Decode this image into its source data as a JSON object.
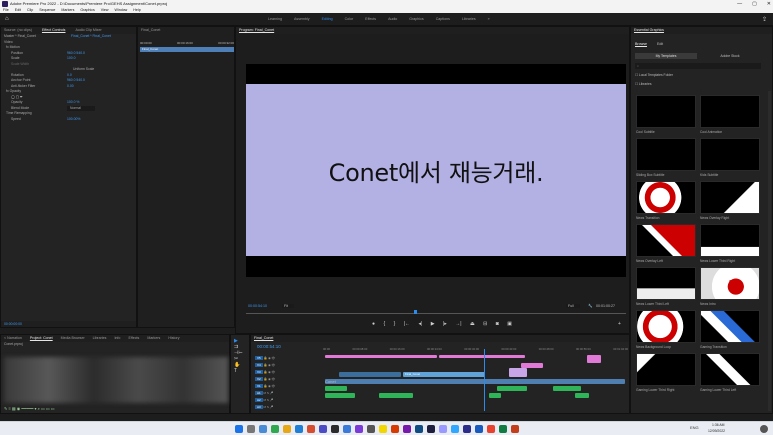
{
  "window": {
    "title": "Adobe Premiere Pro 2022 - D:\\Documents\\Premiere Pro\\GEHS Assignment\\Conet.prproj",
    "controls": [
      "—",
      "▢",
      "✕"
    ]
  },
  "menu": [
    "File",
    "Edit",
    "Clip",
    "Sequence",
    "Markers",
    "Graphics",
    "View",
    "Window",
    "Help"
  ],
  "workspaces": {
    "tabs": [
      "Learning",
      "Assembly",
      "Editing",
      "Color",
      "Effects",
      "Audio",
      "Graphics",
      "Captions",
      "Libraries"
    ],
    "active": "Editing",
    "more": "»"
  },
  "source_panel": {
    "tabs": [
      "Source: (no clips)",
      "Effect Controls",
      "Audio Clip Mixer"
    ],
    "master": "Master * Final_Conet",
    "sequence": "Final_Conet * Final_Conet",
    "rows": [
      "Video",
      "fx Motion",
      "Position",
      "Scale",
      "Scale Width",
      "Uniform Scale",
      "Rotation",
      "Anchor Point",
      "Anti-flicker Filter",
      "fx Opacity",
      "Opacity",
      "Blend Mode",
      "Time Remapping",
      "Speed"
    ],
    "values": {
      "position": "960.0   540.0",
      "scale": "100.0",
      "rotation": "0.0",
      "anchor": "960.0   540.0",
      "antiflicker": "0.00",
      "opacity": "100.0 %",
      "blend": "Normal",
      "speed": "100.00%"
    },
    "timecode": "00:00:00:00",
    "clip_times": [
      "00:00:00",
      "00:00:16:00",
      "00:00:32:00"
    ],
    "clip_name": "Final_Conet"
  },
  "project_panel": {
    "tabs": [
      "< Narration",
      "Project: Conet",
      "Media Browser",
      "Libraries",
      "Info",
      "Effects",
      "Markers",
      "History"
    ],
    "file": "Conet.prproj"
  },
  "program_monitor": {
    "title": "Program: Final_Conet",
    "timecode": "00:00:54:10",
    "fit": "Fit",
    "quality": "Full",
    "duration": "00:01:00:27",
    "caption": "Conet에서 재능거래."
  },
  "timeline": {
    "tab": "Final_Conet",
    "timecode": "00:00:54:10",
    "ruler": [
      "00:00",
      "00:00:08:00",
      "00:00:16:00",
      "00:00:24:00",
      "00:00:32:00",
      "00:00:40:00",
      "00:00:48:00",
      "00:00:56:00",
      "00:01:04:00"
    ],
    "tracks": [
      "V5",
      "V4",
      "V3",
      "V2",
      "V1",
      "A1",
      "A2",
      "A3"
    ],
    "clips": [
      "Final_Conet",
      "Conet"
    ]
  },
  "essential_graphics": {
    "title": "Essential Graphics",
    "tabs": [
      "Browse",
      "Edit"
    ],
    "my_templates": "My Templates",
    "adobe_stock": "Adobe Stock",
    "search_placeholder": "",
    "filters": [
      "Local Templates Folder",
      "Libraries"
    ],
    "items": [
      "Cool Subtitle",
      "Cool Animation",
      "Sliding Box Subtitle",
      "Kids Subtitle",
      "News Transition",
      "News Overlay Right",
      "News Overlay Left",
      "News Lower Third Right",
      "News Lower Third Left",
      "News Intro",
      "News Background Loop",
      "Gaming Transition",
      "Gaming Lower Third Right",
      "Gaming Lower Third Left"
    ],
    "spin_text": "SPIN"
  },
  "taskbar": {
    "time": "1:36 AM",
    "date": "12/09/2022",
    "lang": "ENG"
  },
  "colors": {
    "accent": "#2d8ceb",
    "frame": "#b3b0e3",
    "clip_pink": "#e17ad6",
    "clip_green": "#2fb45a",
    "clip_blue": "#5fa3d9"
  }
}
